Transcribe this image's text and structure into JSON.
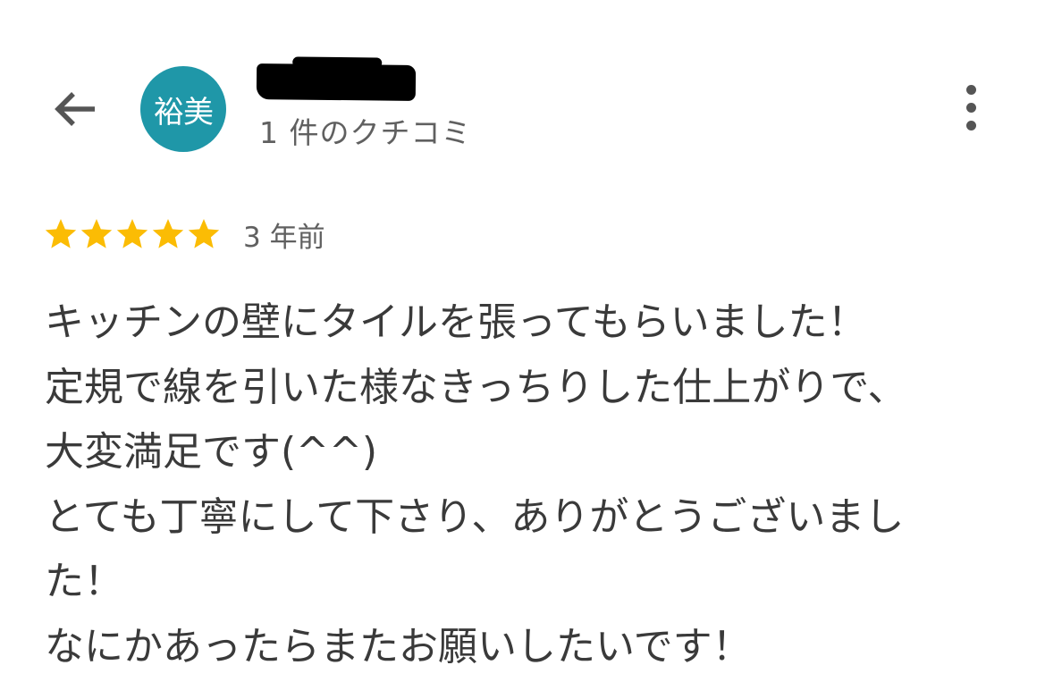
{
  "header": {
    "back_label": "back",
    "avatar_text": "裕美",
    "avatar_color": "#1f97a8",
    "name_redacted": true,
    "review_count": "1 件のクチコミ",
    "more_label": "more"
  },
  "review": {
    "rating": 5,
    "rating_max": 5,
    "star_color": "#fbbc04",
    "relative_time": "3 年前",
    "lines": [
      "キッチンの壁にタイルを張ってもらいました！",
      "定規で線を引いた様なきっちりした仕上がりで、",
      "大変満足です(^^)",
      "とても丁寧にして下さり、ありがとうございまし",
      "た！",
      "なにかあったらまたお願いしたいです！"
    ]
  }
}
